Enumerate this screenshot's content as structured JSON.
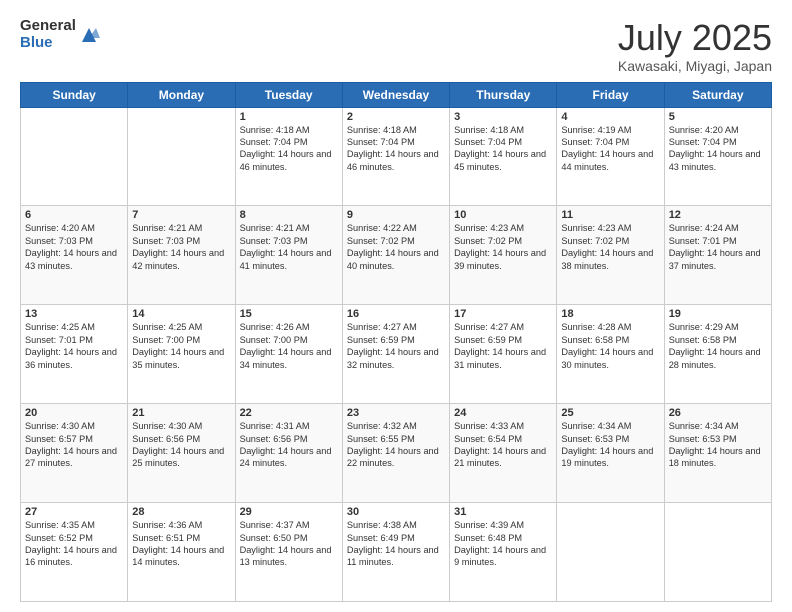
{
  "logo": {
    "general": "General",
    "blue": "Blue"
  },
  "title": "July 2025",
  "location": "Kawasaki, Miyagi, Japan",
  "days_of_week": [
    "Sunday",
    "Monday",
    "Tuesday",
    "Wednesday",
    "Thursday",
    "Friday",
    "Saturday"
  ],
  "weeks": [
    [
      {
        "day": "",
        "text": ""
      },
      {
        "day": "",
        "text": ""
      },
      {
        "day": "1",
        "text": "Sunrise: 4:18 AM\nSunset: 7:04 PM\nDaylight: 14 hours and 46 minutes."
      },
      {
        "day": "2",
        "text": "Sunrise: 4:18 AM\nSunset: 7:04 PM\nDaylight: 14 hours and 46 minutes."
      },
      {
        "day": "3",
        "text": "Sunrise: 4:18 AM\nSunset: 7:04 PM\nDaylight: 14 hours and 45 minutes."
      },
      {
        "day": "4",
        "text": "Sunrise: 4:19 AM\nSunset: 7:04 PM\nDaylight: 14 hours and 44 minutes."
      },
      {
        "day": "5",
        "text": "Sunrise: 4:20 AM\nSunset: 7:04 PM\nDaylight: 14 hours and 43 minutes."
      }
    ],
    [
      {
        "day": "6",
        "text": "Sunrise: 4:20 AM\nSunset: 7:03 PM\nDaylight: 14 hours and 43 minutes."
      },
      {
        "day": "7",
        "text": "Sunrise: 4:21 AM\nSunset: 7:03 PM\nDaylight: 14 hours and 42 minutes."
      },
      {
        "day": "8",
        "text": "Sunrise: 4:21 AM\nSunset: 7:03 PM\nDaylight: 14 hours and 41 minutes."
      },
      {
        "day": "9",
        "text": "Sunrise: 4:22 AM\nSunset: 7:02 PM\nDaylight: 14 hours and 40 minutes."
      },
      {
        "day": "10",
        "text": "Sunrise: 4:23 AM\nSunset: 7:02 PM\nDaylight: 14 hours and 39 minutes."
      },
      {
        "day": "11",
        "text": "Sunrise: 4:23 AM\nSunset: 7:02 PM\nDaylight: 14 hours and 38 minutes."
      },
      {
        "day": "12",
        "text": "Sunrise: 4:24 AM\nSunset: 7:01 PM\nDaylight: 14 hours and 37 minutes."
      }
    ],
    [
      {
        "day": "13",
        "text": "Sunrise: 4:25 AM\nSunset: 7:01 PM\nDaylight: 14 hours and 36 minutes."
      },
      {
        "day": "14",
        "text": "Sunrise: 4:25 AM\nSunset: 7:00 PM\nDaylight: 14 hours and 35 minutes."
      },
      {
        "day": "15",
        "text": "Sunrise: 4:26 AM\nSunset: 7:00 PM\nDaylight: 14 hours and 34 minutes."
      },
      {
        "day": "16",
        "text": "Sunrise: 4:27 AM\nSunset: 6:59 PM\nDaylight: 14 hours and 32 minutes."
      },
      {
        "day": "17",
        "text": "Sunrise: 4:27 AM\nSunset: 6:59 PM\nDaylight: 14 hours and 31 minutes."
      },
      {
        "day": "18",
        "text": "Sunrise: 4:28 AM\nSunset: 6:58 PM\nDaylight: 14 hours and 30 minutes."
      },
      {
        "day": "19",
        "text": "Sunrise: 4:29 AM\nSunset: 6:58 PM\nDaylight: 14 hours and 28 minutes."
      }
    ],
    [
      {
        "day": "20",
        "text": "Sunrise: 4:30 AM\nSunset: 6:57 PM\nDaylight: 14 hours and 27 minutes."
      },
      {
        "day": "21",
        "text": "Sunrise: 4:30 AM\nSunset: 6:56 PM\nDaylight: 14 hours and 25 minutes."
      },
      {
        "day": "22",
        "text": "Sunrise: 4:31 AM\nSunset: 6:56 PM\nDaylight: 14 hours and 24 minutes."
      },
      {
        "day": "23",
        "text": "Sunrise: 4:32 AM\nSunset: 6:55 PM\nDaylight: 14 hours and 22 minutes."
      },
      {
        "day": "24",
        "text": "Sunrise: 4:33 AM\nSunset: 6:54 PM\nDaylight: 14 hours and 21 minutes."
      },
      {
        "day": "25",
        "text": "Sunrise: 4:34 AM\nSunset: 6:53 PM\nDaylight: 14 hours and 19 minutes."
      },
      {
        "day": "26",
        "text": "Sunrise: 4:34 AM\nSunset: 6:53 PM\nDaylight: 14 hours and 18 minutes."
      }
    ],
    [
      {
        "day": "27",
        "text": "Sunrise: 4:35 AM\nSunset: 6:52 PM\nDaylight: 14 hours and 16 minutes."
      },
      {
        "day": "28",
        "text": "Sunrise: 4:36 AM\nSunset: 6:51 PM\nDaylight: 14 hours and 14 minutes."
      },
      {
        "day": "29",
        "text": "Sunrise: 4:37 AM\nSunset: 6:50 PM\nDaylight: 14 hours and 13 minutes."
      },
      {
        "day": "30",
        "text": "Sunrise: 4:38 AM\nSunset: 6:49 PM\nDaylight: 14 hours and 11 minutes."
      },
      {
        "day": "31",
        "text": "Sunrise: 4:39 AM\nSunset: 6:48 PM\nDaylight: 14 hours and 9 minutes."
      },
      {
        "day": "",
        "text": ""
      },
      {
        "day": "",
        "text": ""
      }
    ]
  ]
}
